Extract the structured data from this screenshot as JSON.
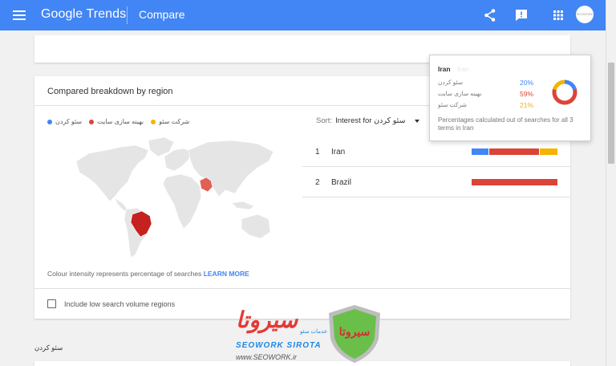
{
  "colors": {
    "blue": "#4285f4",
    "red": "#db4437",
    "yellow": "#f4b400",
    "appbar": "#4285f4"
  },
  "appbar": {
    "logo": "Google Trends",
    "title": "Compare",
    "icons": [
      "menu-icon",
      "share-icon",
      "feedback-icon",
      "apps-icon"
    ],
    "avatar_text": "SEOWORK"
  },
  "breakdown": {
    "title": "Compared breakdown by region",
    "legend": [
      {
        "label": "سئو کردن",
        "color": "#4285f4"
      },
      {
        "label": "بهینه سازی سایت",
        "color": "#db4437"
      },
      {
        "label": "شرکت سئو",
        "color": "#f4b400"
      }
    ],
    "sort_label": "Sort:",
    "sort_value": "Interest for سئو کردن",
    "rows": [
      {
        "rank": "1",
        "name": "Iran",
        "shares": [
          20,
          59,
          21
        ]
      },
      {
        "rank": "2",
        "name": "Brazil",
        "shares": [
          0,
          100,
          0
        ]
      }
    ],
    "note": "Colour intensity represents percentage of searches",
    "learn_more": "LEARN MORE",
    "checkbox_label": "Include low search volume regions"
  },
  "tooltip": {
    "title": "Iran",
    "ghost": "Iran",
    "rows": [
      {
        "term": "سئو کردن",
        "pct": "20%",
        "value": 20,
        "color": "#4285f4"
      },
      {
        "term": "بهینه سازی سایت",
        "pct": "59%",
        "value": 59,
        "color": "#db4437"
      },
      {
        "term": "شرکت سئو",
        "pct": "21%",
        "value": 21,
        "color": "#f4b400"
      }
    ],
    "footer": "Percentages calculated out of searches for all 3 terms in Iran"
  },
  "bottom": {
    "term_label": "سئو کردن"
  },
  "watermark": {
    "brand": "سیروتا",
    "small": "خدمات سئو",
    "line1": "SEOWORK SIROTA",
    "line2": "www.SEOWORK.ir",
    "shield_text": "سیروتا"
  }
}
